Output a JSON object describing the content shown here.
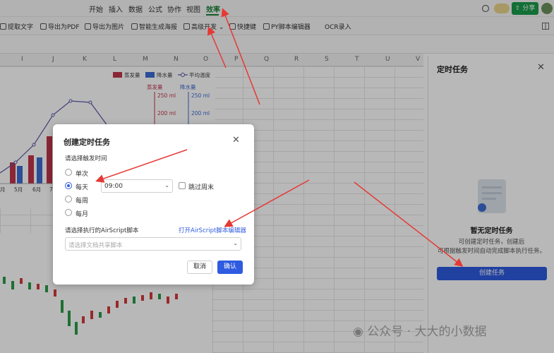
{
  "menu": {
    "items": [
      "开始",
      "插入",
      "数据",
      "公式",
      "协作",
      "视图",
      "效率"
    ],
    "active": "效率",
    "share_label": "分享"
  },
  "toolbar": {
    "items": [
      "提取文字",
      "导出为PDF",
      "导出为图片",
      "智能生成海报",
      "高级开发",
      "快捷键",
      "PY脚本编辑器",
      "OCR录入"
    ]
  },
  "columns": [
    "I",
    "J",
    "K",
    "L",
    "M",
    "N",
    "O",
    "P",
    "Q",
    "R",
    "S",
    "T",
    "U",
    "V"
  ],
  "chart_data": {
    "type": "bar",
    "legend": [
      "蒸发量",
      "降水量",
      "平均温度"
    ],
    "axis_titles": [
      "蒸发量",
      "降水量"
    ],
    "axis_ticks_left": [
      "250 ml",
      "200 ml"
    ],
    "axis_ticks_right": [
      "250 ml",
      "200 ml"
    ],
    "categories": [
      "月",
      "5月",
      "6月",
      "7"
    ]
  },
  "panel": {
    "title": "定时任务",
    "empty_title": "暂无定时任务",
    "desc_line1": "可创建定时任务，创建后",
    "desc_line2": "可根据触发时间自动完成脚本执行任务。",
    "create_button": "创建任务"
  },
  "dialog": {
    "title": "创建定时任务",
    "trigger_label": "请选择触发时间",
    "options": [
      "单次",
      "每天",
      "每周",
      "每月"
    ],
    "selected": "每天",
    "time_value": "09:00",
    "skip_weekend": "跳过周末",
    "script_label": "请选择执行的AirScript脚本",
    "open_editor_link": "打开AirScript脚本编辑器",
    "script_placeholder": "请选择文档共享脚本",
    "cancel": "取消",
    "confirm": "确认"
  },
  "watermark": "公众号 · 大大的小数据"
}
